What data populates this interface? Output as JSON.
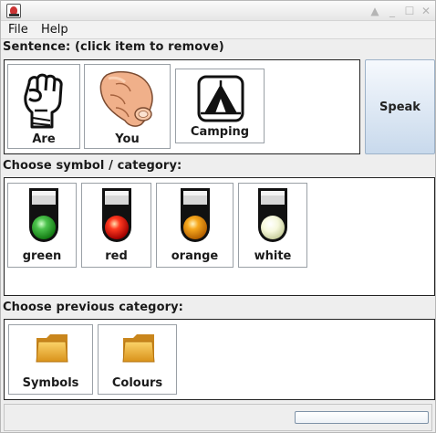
{
  "menu": {
    "file": "File",
    "help": "Help"
  },
  "sentence": {
    "label": "Sentence:   (click item to remove)",
    "items": [
      {
        "label": "Are",
        "icon": "raised-fist-icon"
      },
      {
        "label": "You",
        "icon": "pointing-hand-icon"
      },
      {
        "label": "Camping",
        "icon": "tent-icon"
      }
    ]
  },
  "speak": {
    "label": "Speak"
  },
  "symbols": {
    "label": "Choose symbol / category:",
    "items": [
      {
        "label": "green",
        "icon": "green-light-icon",
        "color": "#2ea02e"
      },
      {
        "label": "red",
        "icon": "red-light-icon",
        "color": "#e01a12"
      },
      {
        "label": "orange",
        "icon": "orange-light-icon",
        "color": "#f29a12"
      },
      {
        "label": "white",
        "icon": "white-light-icon",
        "color": "#f4f7d8"
      }
    ]
  },
  "previous": {
    "label": "Choose previous category:",
    "items": [
      {
        "label": "Symbols",
        "icon": "folder-icon"
      },
      {
        "label": "Colours",
        "icon": "folder-icon"
      }
    ]
  },
  "colors": {
    "folder": "#f0b430",
    "speak_button": "#c8d9ec"
  }
}
